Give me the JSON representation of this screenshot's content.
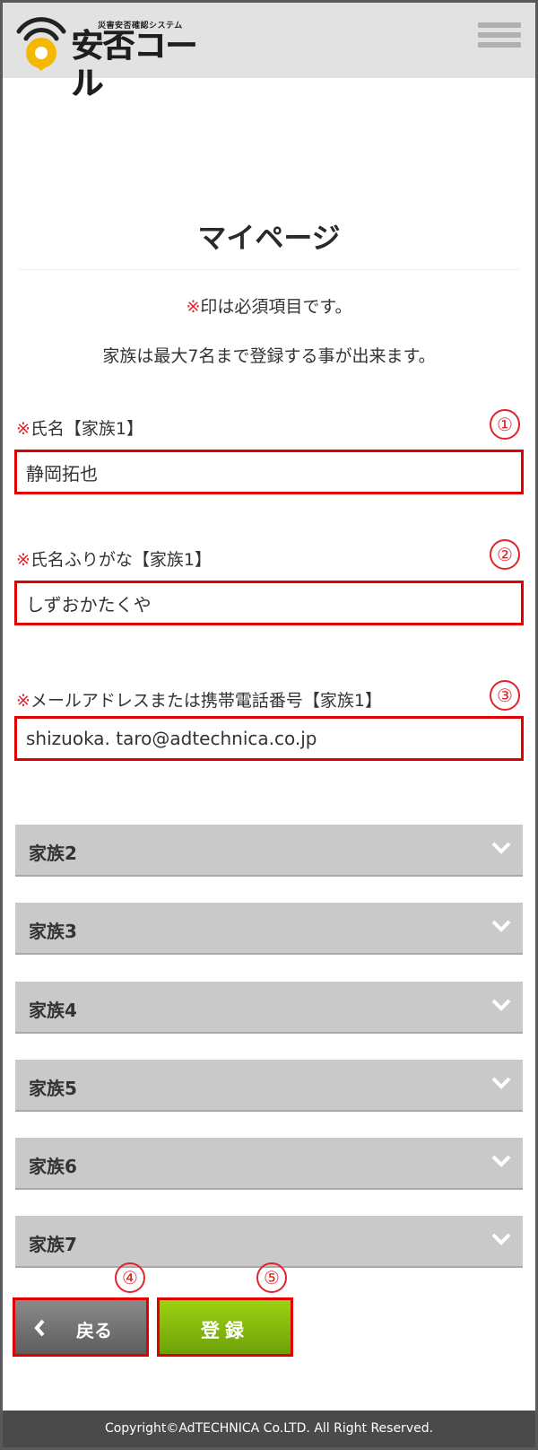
{
  "header": {
    "logo_subtitle": "災害安否確認システム",
    "logo_title": "安否コール",
    "menu_icon": "hamburger-menu-icon"
  },
  "page": {
    "title": "マイページ",
    "required_mark": "※",
    "required_note": "印は必須項目です。",
    "family_note": "家族は最大7名まで登録する事が出来ます。"
  },
  "fields": [
    {
      "badge": "①",
      "required_mark": "※",
      "label": "氏名【家族1】",
      "value": "静岡拓也",
      "placeholder": ""
    },
    {
      "badge": "②",
      "required_mark": "※",
      "label": "氏名ふりがな【家族1】",
      "value": "しずおかたくや",
      "placeholder": ""
    },
    {
      "badge": "③",
      "required_mark": "※",
      "label": "メールアドレスまたは携帯電話番号【家族1】",
      "value": "shizuoka. taro@adtechnica.co.jp",
      "placeholder": ""
    }
  ],
  "family_sections": [
    {
      "label": "家族2"
    },
    {
      "label": "家族3"
    },
    {
      "label": "家族4"
    },
    {
      "label": "家族5"
    },
    {
      "label": "家族6"
    },
    {
      "label": "家族7"
    }
  ],
  "buttons": {
    "back_badge": "④",
    "back_label": "戻る",
    "submit_badge": "⑤",
    "submit_label": "登録"
  },
  "footer": {
    "copyright": "Copyright©AdTECHNICA Co.LTD. All Right Reserved."
  },
  "colors": {
    "accent_red": "#e0242c",
    "submit_green": "#84bb0d",
    "logo_yellow": "#f5b800",
    "header_bg": "#e2e2e2",
    "footer_bg": "#4a4a4a"
  }
}
